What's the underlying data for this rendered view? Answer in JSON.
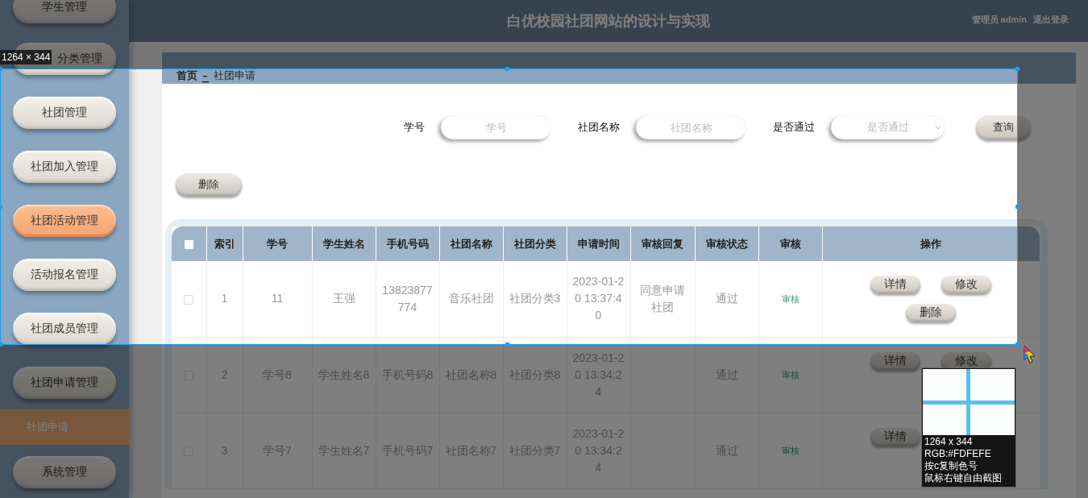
{
  "sidebar": {
    "items": [
      {
        "label": "学生管理",
        "highlighted": false
      },
      {
        "label": "分类管理",
        "highlighted": false
      },
      {
        "label": "社团管理",
        "highlighted": false
      },
      {
        "label": "社团加入管理",
        "highlighted": false
      },
      {
        "label": "社团活动管理",
        "highlighted": true
      },
      {
        "label": "活动报名管理",
        "highlighted": false
      },
      {
        "label": "社团成员管理",
        "highlighted": false
      },
      {
        "label": "社团申请管理",
        "highlighted": false,
        "children": [
          {
            "label": "社团申请",
            "selected": true
          }
        ]
      },
      {
        "label": "系统管理",
        "highlighted": false
      }
    ]
  },
  "header": {
    "title": "白优校园社团网站的设计与实现",
    "user": "管理员 admin",
    "logout": "退出登录"
  },
  "breadcrumb": [
    "首页",
    "社团申请"
  ],
  "search": {
    "fields": [
      {
        "label": "学号",
        "placeholder": "学号",
        "kind": "text"
      },
      {
        "label": "社团名称",
        "placeholder": "社团名称",
        "kind": "text"
      },
      {
        "label": "是否通过",
        "placeholder": "是否通过",
        "kind": "select"
      }
    ],
    "button": "查询"
  },
  "toolbar": {
    "delete_button": "删除"
  },
  "table": {
    "select_all_checked": false,
    "columns": [
      "索引",
      "学号",
      "学生姓名",
      "手机号码",
      "社团名称",
      "社团分类",
      "申请时间",
      "审核回复",
      "审核状态",
      "审核",
      "操作"
    ],
    "rows": [
      {
        "checked": false,
        "index": "1",
        "student_no": "11",
        "student_name": "王强",
        "phone": "13823877774",
        "club_name": "音乐社团",
        "club_category": "社团分类3",
        "apply_time": "2023-01-20 13:37:40",
        "reply": "同意申请社团",
        "status": "通过",
        "audit": "审核",
        "actions": [
          {
            "label": "详情",
            "kind": "detail"
          },
          {
            "label": "修改",
            "kind": "edit"
          },
          {
            "label": "删除",
            "kind": "delete"
          }
        ]
      },
      {
        "checked": false,
        "index": "2",
        "student_no": "学号8",
        "student_name": "学生姓名8",
        "phone": "手机号码8",
        "club_name": "社团名称8",
        "club_category": "社团分类8",
        "apply_time": "2023-01-20 13:34:24",
        "status": "通过",
        "audit": "审核",
        "actions": [
          {
            "label": "详情",
            "kind": "detail"
          },
          {
            "label": "修改",
            "kind": "edit"
          }
        ]
      },
      {
        "checked": false,
        "index": "3",
        "student_no": "学号7",
        "student_name": "学生姓名7",
        "phone": "手机号码7",
        "club_name": "社团名称7",
        "club_category": "社团分类7",
        "apply_time": "2023-01-20 13:34:24",
        "status": "通过",
        "audit": "审核",
        "actions": [
          {
            "label": "详情",
            "kind": "detail"
          }
        ]
      }
    ]
  },
  "screenshot_overlay": {
    "size_label": "1264 × 344",
    "magnifier_lines": [
      "1264 x 344",
      "RGB:#FDFEFE",
      "按c复制色号",
      "鼠标右键自由截图"
    ]
  }
}
